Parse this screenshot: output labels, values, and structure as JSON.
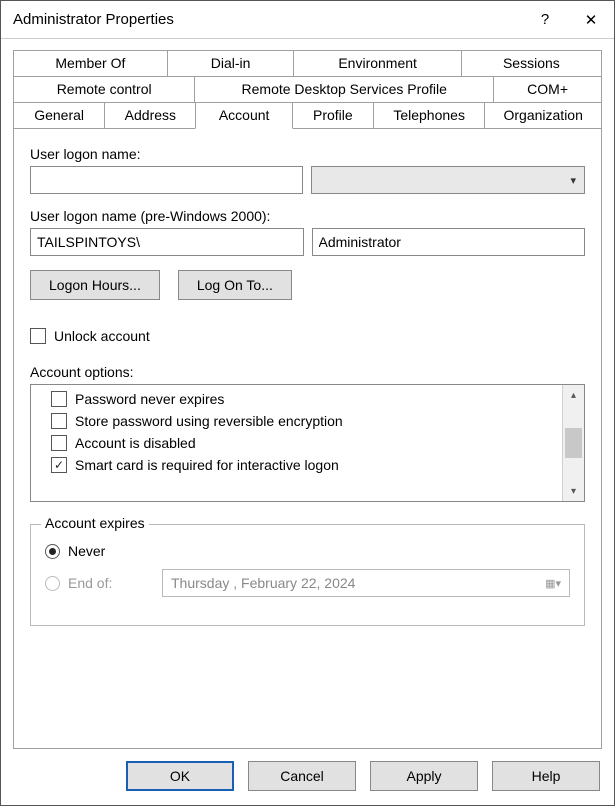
{
  "window": {
    "title": "Administrator Properties",
    "help_symbol": "?",
    "close_symbol": "✕"
  },
  "tabs": {
    "row1": [
      "Member Of",
      "Dial-in",
      "Environment",
      "Sessions"
    ],
    "row2": [
      "Remote control",
      "Remote Desktop Services Profile",
      "COM+"
    ],
    "row3": [
      "General",
      "Address",
      "Account",
      "Profile",
      "Telephones",
      "Organization"
    ],
    "active": "Account"
  },
  "logon": {
    "label1": "User logon name:",
    "name_value": "",
    "suffix_value": "",
    "label2": "User logon name (pre-Windows 2000):",
    "domain_value": "TAILSPINTOYS\\",
    "user_value": "Administrator",
    "btn_hours": "Logon Hours...",
    "btn_logonto": "Log On To..."
  },
  "unlock": {
    "label": "Unlock account",
    "checked": false
  },
  "options": {
    "label": "Account options:",
    "items": [
      {
        "text": "Password never expires",
        "checked": false
      },
      {
        "text": "Store password using reversible encryption",
        "checked": false
      },
      {
        "text": "Account is disabled",
        "checked": false
      },
      {
        "text": "Smart card is required for interactive logon",
        "checked": true
      }
    ]
  },
  "expires": {
    "legend": "Account expires",
    "never": "Never",
    "endof": "End of:",
    "selected": "never",
    "date_text": "Thursday ,   February  22, 2024"
  },
  "footer": {
    "ok": "OK",
    "cancel": "Cancel",
    "apply": "Apply",
    "help": "Help"
  }
}
